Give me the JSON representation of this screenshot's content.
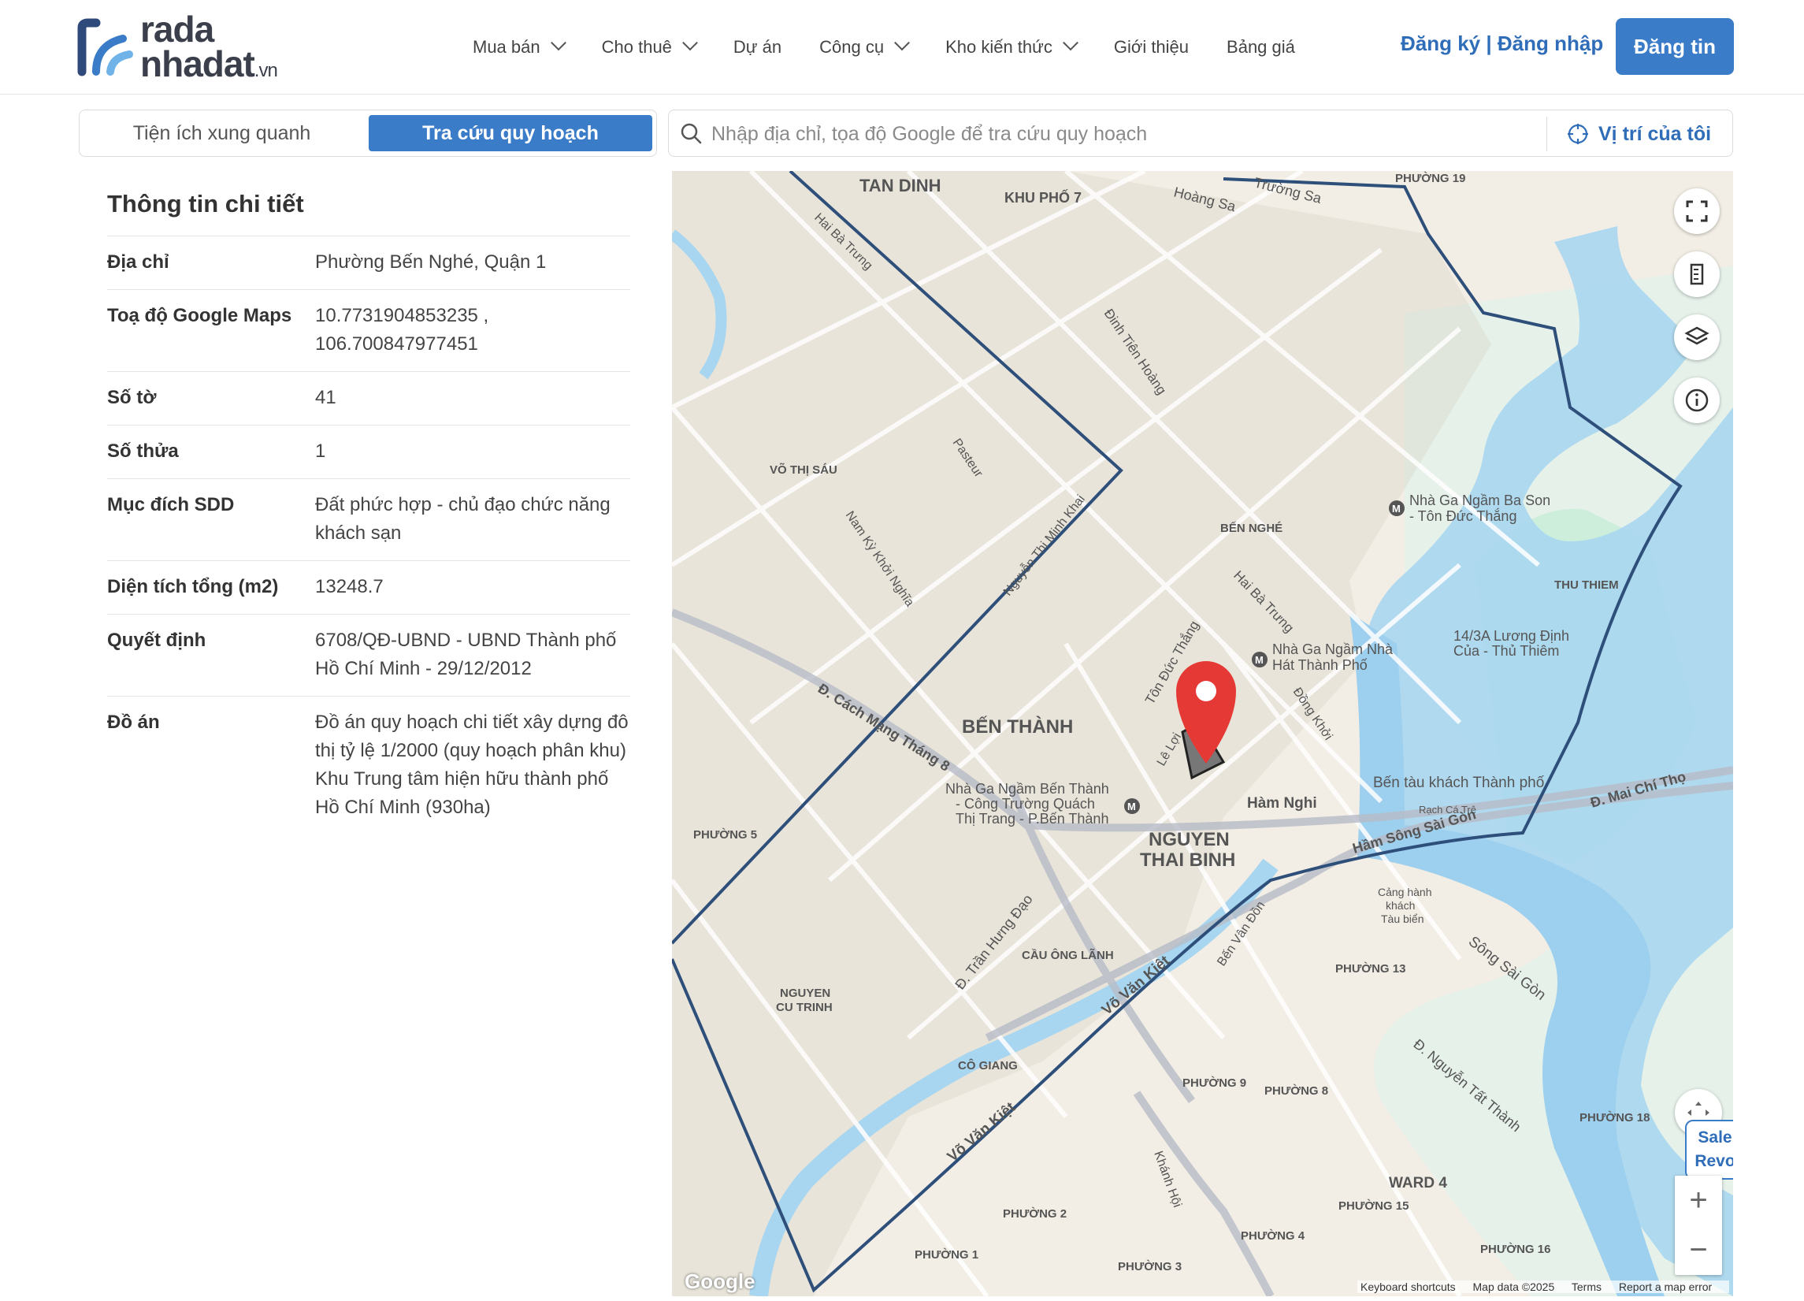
{
  "header": {
    "logo_line1": "rada",
    "logo_line2": "nhadat",
    "logo_suffix": ".vn",
    "nav": [
      {
        "label": "Mua bán",
        "dropdown": true
      },
      {
        "label": "Cho thuê",
        "dropdown": true
      },
      {
        "label": "Dự án",
        "dropdown": false
      },
      {
        "label": "Công cụ",
        "dropdown": true
      },
      {
        "label": "Kho kiến thức",
        "dropdown": true
      },
      {
        "label": "Giới thiệu",
        "dropdown": false
      },
      {
        "label": "Bảng giá",
        "dropdown": false
      }
    ],
    "auth_label": "Đăng ký | Đăng nhập",
    "post_label": "Đăng tin"
  },
  "tabs": {
    "amenities": "Tiện ích xung quanh",
    "lookup": "Tra cứu quy hoạch"
  },
  "search": {
    "placeholder": "Nhập địa chỉ, tọa độ Google để tra cứu quy hoạch",
    "value": "",
    "locate_label": "Vị trí của tôi"
  },
  "details": {
    "title": "Thông tin chi tiết",
    "rows": [
      {
        "key": "Địa chỉ",
        "value": "Phường Bến Nghé, Quận 1"
      },
      {
        "key": "Toạ độ Google Maps",
        "value": "10.7731904853235 , 106.700847977451"
      },
      {
        "key": "Số tờ",
        "value": "41"
      },
      {
        "key": "Số thửa",
        "value": "1"
      },
      {
        "key": "Mục đích SDD",
        "value": "Đất phức hợp - chủ đạo chức năng khách sạn"
      },
      {
        "key": "Diện tích tổng (m2)",
        "value": "13248.7"
      },
      {
        "key": "Quyết định",
        "value": "6708/QĐ-UBND - UBND Thành phố Hồ Chí Minh - 29/12/2012"
      },
      {
        "key": "Đồ án",
        "value": "Đồ án quy hoạch chi tiết xây dựng đô thị tỷ lệ 1/2000 (quy hoạch phân khu) Khu Trung tâm hiện hữu thành phố Hồ Chí Minh (930ha)"
      }
    ]
  },
  "map": {
    "labels": {
      "tan_dinh": "TAN DINH",
      "khu_pho_7": "KHU PHỐ 7",
      "ben_thanh": "BẾN THÀNH",
      "nguyen_thai_binh_1": "NGUYEN",
      "nguyen_thai_binh_2": "THAI BINH",
      "ben_nghe": "BẾN NGHÉ",
      "thu_thiem": "THU THIEM",
      "vo_thi_sau": "VÕ THỊ SÁU",
      "cau_ong_lanh": "CẦU ÔNG LÃNH",
      "co_giang": "CÔ GIANG",
      "nguyen_cu_trinh_1": "NGUYEN",
      "nguyen_cu_trinh_2": "CU TRINH",
      "phuong_13": "PHƯỜNG 13",
      "phuong_9": "PHƯỜNG 9",
      "phuong_8": "PHƯỜNG 8",
      "phuong_18": "PHƯỜNG 18",
      "ward_4": "WARD 4",
      "phuong_15": "PHƯỜNG 15",
      "phuong_2": "PHƯỜNG 2",
      "phuong_4": "PHƯỜNG 4",
      "phuong_16": "PHƯỜNG 16",
      "phuong_1": "PHƯỜNG 1",
      "phuong_3": "PHƯỜNG 3",
      "phuong_5": "PHƯỜNG 5",
      "phuong_19": "PHƯỜNG 19",
      "metro_ba_son_1": "Nhà Ga Ngầm Ba Son",
      "metro_ba_son_2": "- Tôn Đức Thắng",
      "metro_opera_1": "Nhà Ga Ngầm Nhà",
      "metro_opera_2": "Hát Thành Phố",
      "metro_ben_thanh_1": "Nhà Ga Ngầm Bến Thành",
      "metro_ben_thanh_2": "- Công Trường Quách",
      "metro_ben_thanh_3": "Thị Trang - P.Bến Thành",
      "luong_dinh_cua_1": "14/3A Lương Định",
      "luong_dinh_cua_2": "Của - Thủ Thiêm",
      "ben_tau": "Bến tàu khách Thành phố",
      "song_sai_gon": "Sông Sài Gòn",
      "ham_song_sai_gon": "Hầm Sông Sài Gòn",
      "ham_nghi": "Hàm Nghi",
      "cach_mang_thang_8": "Đ. Cách Mạng Tháng 8",
      "vo_van_kiet": "Võ Văn Kiệt",
      "vo_van_kiet_2": "Võ Văn Kiệt",
      "mai_chi_tho": "Đ. Mai Chí Thọ",
      "nguyen_thi_minh_khai": "Nguyễn Thị Minh Khai",
      "hai_ba_trung": "Hai Bà Trưng",
      "hai_ba_trung_2": "Hai Bà Trưng",
      "ton_duc_thang": "Tôn Đức Thắng",
      "nguyen_tat_thanh": "Đ. Nguyễn Tất Thành",
      "tran_hung_dao": "Đ. Trần Hưng Đạo",
      "truong_sa": "Trường Sa",
      "hoang_sa": "Hoàng Sa",
      "dinh_tien_hoang": "Đinh Tiên Hoàng",
      "pasteur": "Pasteur",
      "nam_ky_khoi_nghia": "Nam Kỳ Khởi Nghĩa",
      "le_loi": "Lê Lợi",
      "dong_khoi": "Đồng Khởi",
      "ben_van_don": "Bến Vân Đồn",
      "cang_1": "Cảng hành",
      "cang_2": "khách",
      "cang_3": "Tàu biển",
      "khanh_hoi": "Khánh Hội",
      "rach_ca_tre": "Rạch Cá Trê"
    },
    "sale_line1": "Sale",
    "sale_line2": "Revo",
    "zoom_in": "+",
    "zoom_out": "−",
    "google": "Google",
    "attribution": {
      "shortcuts": "Keyboard shortcuts",
      "data": "Map data ©2025",
      "terms": "Terms",
      "report": "Report a map error"
    }
  }
}
